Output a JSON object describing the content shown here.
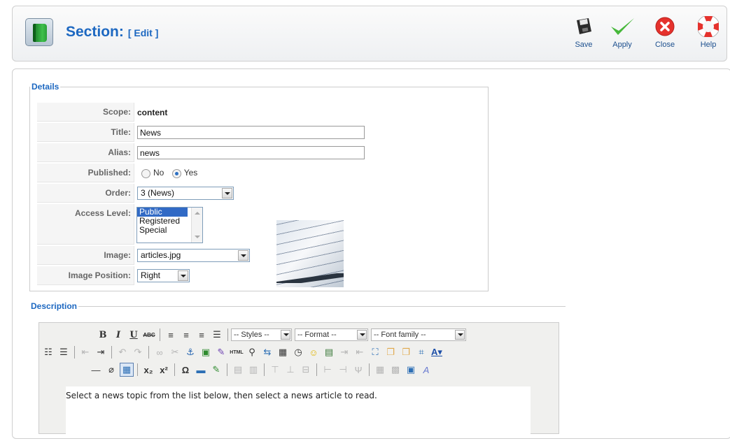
{
  "header": {
    "title": "Section:",
    "edit_label": "[ Edit ]",
    "buttons": {
      "save": "Save",
      "apply": "Apply",
      "close": "Close",
      "help": "Help"
    }
  },
  "details": {
    "legend": "Details",
    "scope_label": "Scope:",
    "scope_value": "content",
    "title_label": "Title:",
    "title_value": "News",
    "alias_label": "Alias:",
    "alias_value": "news",
    "published_label": "Published:",
    "published_options": [
      "No",
      "Yes"
    ],
    "published_selected": "Yes",
    "order_label": "Order:",
    "order_value": "3 (News)",
    "access_label": "Access Level:",
    "access_options": [
      "Public",
      "Registered",
      "Special"
    ],
    "access_selected": "Public",
    "image_label": "Image:",
    "image_value": "articles.jpg",
    "image_position_label": "Image Position:",
    "image_position_value": "Right"
  },
  "description": {
    "legend": "Description",
    "toolbar": {
      "styles": "-- Styles --",
      "format": "-- Format --",
      "font_family": "-- Font family --"
    },
    "content": "Select a news topic from the list below, then select a news article to read."
  },
  "colors": {
    "accent": "#1d68c1",
    "apply_green": "#47b83b",
    "close_red": "#e5322d"
  }
}
